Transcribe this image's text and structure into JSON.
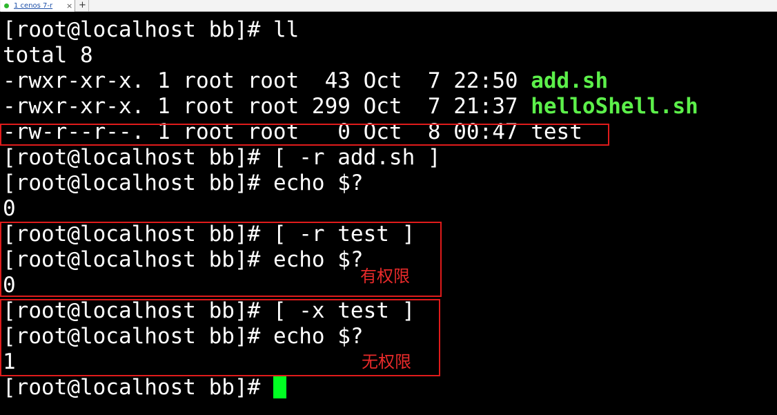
{
  "tab": {
    "label": "1 cenos 7-r",
    "close": "×",
    "add": "+"
  },
  "terminal": {
    "lines": [
      {
        "prompt": "[root@localhost bb]# ",
        "command": "ll"
      },
      {
        "text": "total 8"
      },
      {
        "meta": "-rwxr-xr-x. 1 root root  43 Oct  7 22:50 ",
        "filename": "add.sh"
      },
      {
        "meta": "-rwxr-xr-x. 1 root root 299 Oct  7 21:37 ",
        "filename": "helloShell.sh"
      },
      {
        "meta": "-rw-r--r--. 1 root root   0 Oct  8 00:47 ",
        "filename": "test"
      },
      {
        "prompt": "[root@localhost bb]# ",
        "command": "[ -r add.sh ]"
      },
      {
        "prompt": "[root@localhost bb]# ",
        "command": "echo $?"
      },
      {
        "text": "0"
      },
      {
        "prompt": "[root@localhost bb]# ",
        "command": "[ -r test ]"
      },
      {
        "prompt": "[root@localhost bb]# ",
        "command": "echo $?"
      },
      {
        "text": "0"
      },
      {
        "prompt": "[root@localhost bb]# ",
        "command": "[ -x test ]"
      },
      {
        "prompt": "[root@localhost bb]# ",
        "command": "echo $?"
      },
      {
        "text": "1"
      },
      {
        "prompt": "[root@localhost bb]# ",
        "command": ""
      }
    ]
  },
  "annotations": {
    "has_permission": "有权限",
    "no_permission": "无权限"
  },
  "colors": {
    "background": "#000000",
    "text": "#ffffff",
    "executable_file": "#5cf04a",
    "cursor": "#00ff22",
    "annotation": "#e01b1b"
  }
}
